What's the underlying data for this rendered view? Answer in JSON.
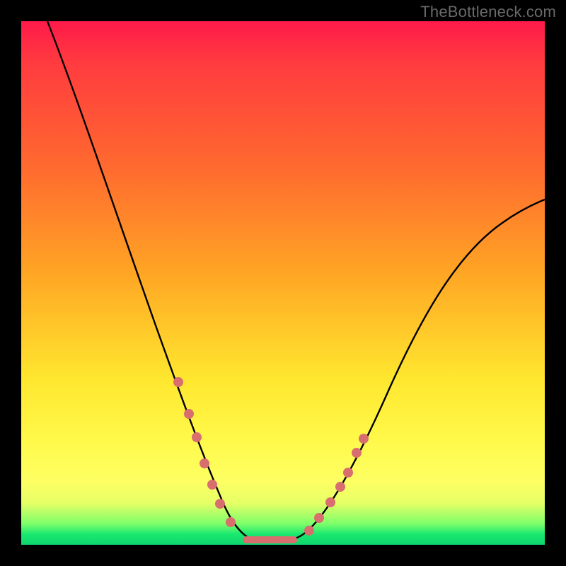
{
  "watermark": "TheBottleneck.com",
  "chart_data": {
    "type": "line",
    "title": "",
    "xlabel": "",
    "ylabel": "",
    "xlim": [
      0,
      100
    ],
    "ylim": [
      0,
      100
    ],
    "grid": false,
    "legend": false,
    "series": [
      {
        "name": "curve",
        "x": [
          5,
          10,
          15,
          20,
          25,
          30,
          33,
          36,
          38,
          40,
          42,
          45,
          50,
          55,
          60,
          65,
          70,
          75,
          80,
          85,
          90,
          95,
          100
        ],
        "y": [
          100,
          87,
          73,
          59,
          45,
          31,
          22,
          13,
          8,
          4,
          1,
          0,
          0,
          2,
          7,
          15,
          24,
          33,
          41,
          48,
          54,
          59,
          63
        ]
      }
    ],
    "highlighted_points": {
      "comment": "salmon dots on curve near bottom",
      "left_branch": [
        {
          "x": 30,
          "y": 31
        },
        {
          "x": 32,
          "y": 25
        },
        {
          "x": 33.5,
          "y": 20
        },
        {
          "x": 35,
          "y": 15
        },
        {
          "x": 36.5,
          "y": 11
        },
        {
          "x": 38,
          "y": 8
        },
        {
          "x": 40,
          "y": 4
        }
      ],
      "plateau": [
        {
          "x": 43,
          "y": 0.5
        },
        {
          "x": 52,
          "y": 0.5
        }
      ],
      "right_branch": [
        {
          "x": 55,
          "y": 2
        },
        {
          "x": 57,
          "y": 4
        },
        {
          "x": 59,
          "y": 7
        },
        {
          "x": 61,
          "y": 10
        },
        {
          "x": 62.5,
          "y": 13
        },
        {
          "x": 64,
          "y": 17
        },
        {
          "x": 65.5,
          "y": 20
        }
      ]
    },
    "background_gradient": {
      "top": "#ff1a4a",
      "mid1": "#ff6a2f",
      "mid2": "#ffe62e",
      "bottom": "#10d66e"
    }
  }
}
